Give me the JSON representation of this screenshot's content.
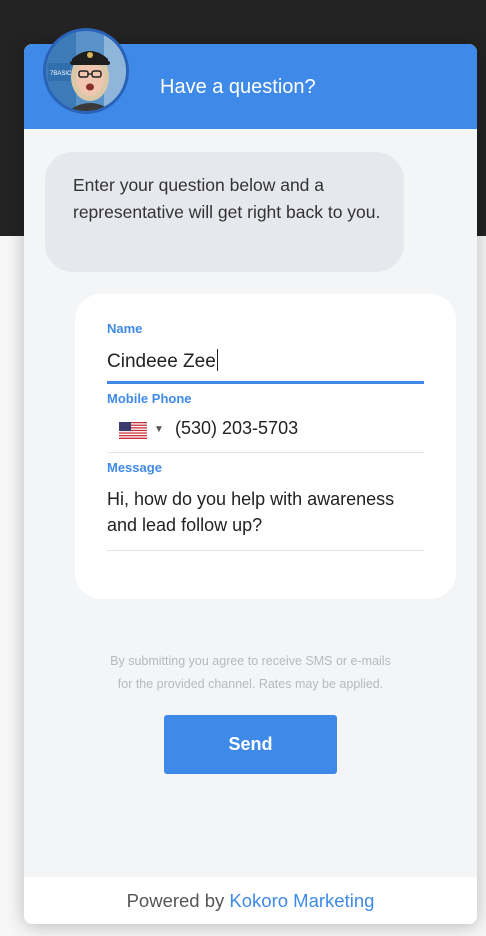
{
  "header": {
    "title": "Have a question?",
    "accent_color": "#3f8ae8"
  },
  "avatar": {
    "sign_text": "7 BASICS"
  },
  "intro_message": "Enter your question below and a representative will get right back to you.",
  "form": {
    "name": {
      "label": "Name",
      "value": "Cindeee Zee"
    },
    "phone": {
      "label": "Mobile Phone",
      "country_icon": "us-flag-icon",
      "value": "(530) 203-5703"
    },
    "message": {
      "label": "Message",
      "value": "Hi, how do you help with awareness and lead follow up?"
    }
  },
  "disclaimer": {
    "line1": "By submitting you agree to receive SMS or e-mails",
    "line2": "for the provided channel. Rates may be applied."
  },
  "send_label": "Send",
  "footer": {
    "prefix": "Powered by",
    "link": "Kokoro Marketing"
  }
}
